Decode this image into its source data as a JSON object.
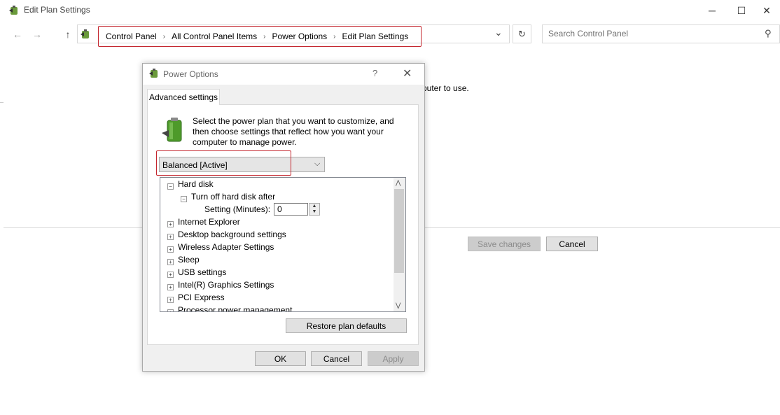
{
  "window": {
    "title": "Edit Plan Settings",
    "minimize_glyph": "─",
    "maximize_glyph": "☐",
    "close_glyph": "✕"
  },
  "nav": {
    "back_glyph": "←",
    "forward_glyph": "→",
    "up_glyph": "↑",
    "breadcrumbs": [
      "Control Panel",
      "All Control Panel Items",
      "Power Options",
      "Edit Plan Settings"
    ],
    "refresh_glyph": "↻",
    "dropdown_glyph": "⌄"
  },
  "search": {
    "placeholder": "Search Control Panel",
    "icon_glyph": "⚲"
  },
  "background": {
    "partial_text": "puter to use.",
    "save_label": "Save changes",
    "cancel_label": "Cancel"
  },
  "dialog": {
    "title": "Power Options",
    "help_glyph": "?",
    "close_glyph": "✕",
    "tab_label": "Advanced settings",
    "intro": "Select the power plan that you want to customize, and then choose settings that reflect how you want your computer to manage power.",
    "plan_selected": "Balanced [Active]",
    "tree": {
      "hard_disk": "Hard disk",
      "turn_off": "Turn off hard disk after",
      "setting_label": "Setting (Minutes):",
      "setting_value": "0",
      "items": [
        "Internet Explorer",
        "Desktop background settings",
        "Wireless Adapter Settings",
        "Sleep",
        "USB settings",
        "Intel(R) Graphics Settings",
        "PCI Express",
        "Processor power management"
      ]
    },
    "restore_label": "Restore plan defaults",
    "ok_label": "OK",
    "cancel_label": "Cancel",
    "apply_label": "Apply"
  },
  "colors": {
    "highlight_border": "#c4262e",
    "button_bg": "#e1e1e1",
    "dialog_bg": "#f0f0f0"
  }
}
